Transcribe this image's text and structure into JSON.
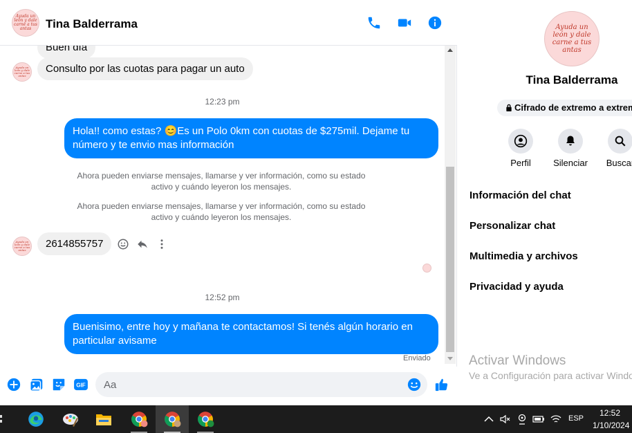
{
  "contact": {
    "name": "Tina Balderrama",
    "avatar_text": "Ayuda un león y dale carne a tus antas"
  },
  "messages": {
    "partial_incoming": "Buen día",
    "incoming_1": "Consulto por las cuotas para pagar un auto",
    "time_1": "12:23 pm",
    "outgoing_1": "Hola!! como estas? 😊Es un Polo 0km con cuotas de $275mil. Dejame tu número y te envio mas información",
    "system_1": "Ahora pueden enviarse mensajes, llamarse y ver información, como su estado activo y cuándo leyeron los mensajes.",
    "system_2": "Ahora pueden enviarse mensajes, llamarse y ver información, como su estado activo y cuándo leyeron los mensajes.",
    "incoming_2": "2614855757",
    "time_2": "12:52 pm",
    "outgoing_2": "Buenisimo, entre hoy y mañana te contactamos! Si tenés algún horario en particular avisame",
    "status": "Enviado"
  },
  "composer": {
    "placeholder": "Aa"
  },
  "info_panel": {
    "name": "Tina Balderrama",
    "e2e_label": "Cifrado de extremo a extremo",
    "actions": [
      {
        "label": "Perfil",
        "icon": "profile-icon"
      },
      {
        "label": "Silenciar",
        "icon": "bell-icon"
      },
      {
        "label": "Buscar",
        "icon": "search-icon"
      }
    ],
    "menu": [
      "Información del chat",
      "Personalizar chat",
      "Multimedia y archivos",
      "Privacidad y ayuda"
    ],
    "watermark_title": "Activar Windows",
    "watermark_sub": "Ve a Configuración para activar Windows."
  },
  "taskbar": {
    "language": "ESP",
    "time": "12:52",
    "date": "1/10/2024"
  },
  "colors": {
    "accent": "#0084ff",
    "bubble_in": "#f0f0f0",
    "taskbar": "#1c1c1c"
  }
}
